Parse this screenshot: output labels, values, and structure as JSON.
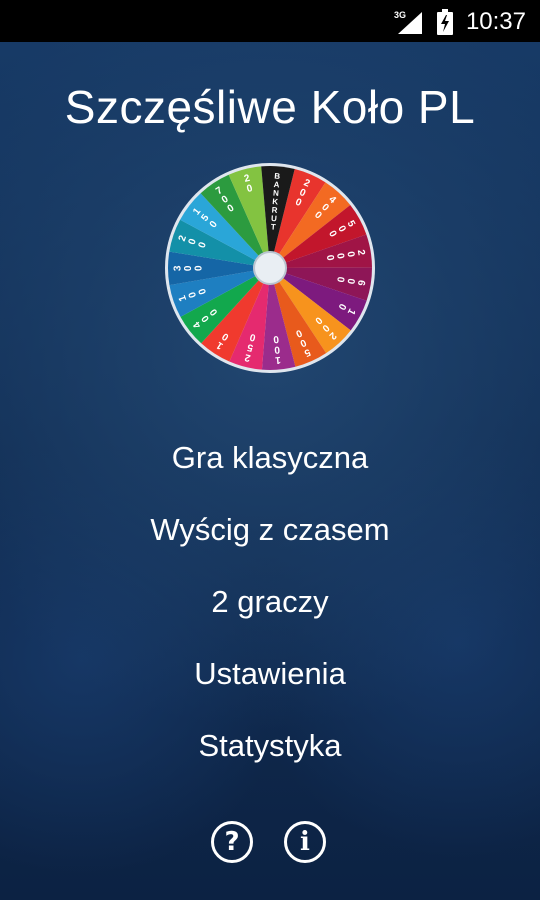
{
  "status_bar": {
    "network": "3G",
    "time": "10:37",
    "icons": [
      "signal-icon",
      "battery-charging-icon"
    ]
  },
  "app": {
    "title": "Szczęśliwe Koło PL"
  },
  "wheel": {
    "icon": "prize-wheel",
    "segments": [
      {
        "label": "200",
        "color": "#e8342d"
      },
      {
        "label": "400",
        "color": "#f36a22"
      },
      {
        "label": "500",
        "color": "#c2162c"
      },
      {
        "label": "2000",
        "color": "#a01446"
      },
      {
        "label": "600",
        "color": "#8e1657"
      },
      {
        "label": "10",
        "color": "#7d1a7e"
      },
      {
        "label": "200",
        "color": "#f7931d"
      },
      {
        "label": "500",
        "color": "#e85a1c"
      },
      {
        "label": "100",
        "color": "#9b2c8c"
      },
      {
        "label": "250",
        "color": "#e52a6f"
      },
      {
        "label": "10",
        "color": "#f03a2e"
      },
      {
        "label": "400",
        "color": "#12a84d"
      },
      {
        "label": "100",
        "color": "#1e7fc1"
      },
      {
        "label": "300",
        "color": "#1566a6"
      },
      {
        "label": "200",
        "color": "#1390a8"
      },
      {
        "label": "150",
        "color": "#2aa6d8"
      },
      {
        "label": "700",
        "color": "#2c9b3f"
      },
      {
        "label": "20",
        "color": "#83c341"
      },
      {
        "label": "BANKRUT",
        "color": "#1a1a1a"
      }
    ]
  },
  "menu": {
    "classic": "Gra klasyczna",
    "race": "Wyścig z czasem",
    "two_players": "2 graczy",
    "settings": "Ustawienia",
    "stats": "Statystyka"
  },
  "bottom": {
    "help_icon": "?",
    "info_icon": "i"
  }
}
